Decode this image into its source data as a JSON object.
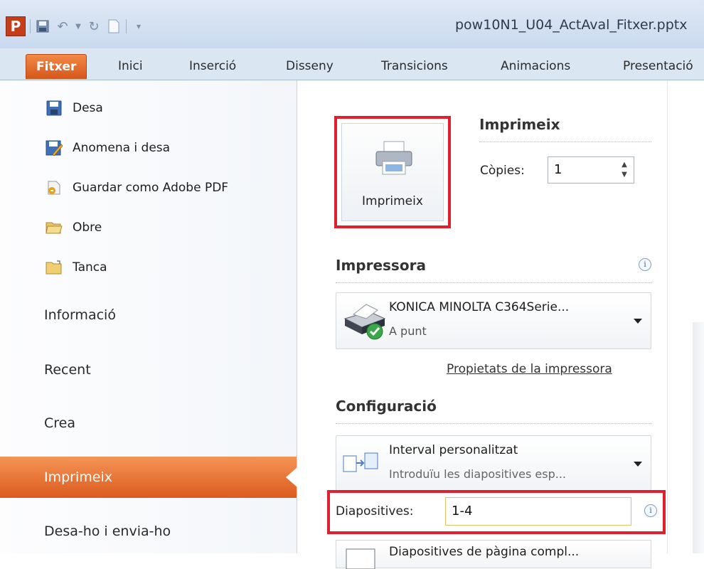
{
  "window": {
    "title": "pow10N1_U04_ActAval_Fitxer.pptx"
  },
  "quick_access": {
    "app_logo": "P"
  },
  "ribbon_tabs": [
    "Fitxer",
    "Inici",
    "Inserció",
    "Disseny",
    "Transicions",
    "Animacions",
    "Presentació"
  ],
  "file_menu": {
    "commands": [
      {
        "label": "Desa",
        "icon": "save-icon"
      },
      {
        "label": "Anomena i desa",
        "icon": "save-as-icon"
      },
      {
        "label": "Guardar como Adobe PDF",
        "icon": "pdf-icon"
      },
      {
        "label": "Obre",
        "icon": "folder-open-icon"
      },
      {
        "label": "Tanca",
        "icon": "folder-close-icon"
      }
    ],
    "nav": [
      "Informació",
      "Recent",
      "Crea",
      "Imprimeix",
      "Desa-ho i envia-ho"
    ],
    "selected": "Imprimeix"
  },
  "print": {
    "button_label": "Imprimeix",
    "heading": "Imprimeix",
    "copies_label": "Còpies:",
    "copies_value": "1"
  },
  "printer": {
    "heading": "Impressora",
    "name": "KONICA MINOLTA C364Serie...",
    "status": "A punt",
    "properties_link": "Propietats de la impressora"
  },
  "settings": {
    "heading": "Configuració",
    "range_title": "Interval personalitzat",
    "range_desc": "Introduïu les diapositives esp...",
    "slides_label": "Diapositives:",
    "slides_value": "1-4",
    "layout_title": "Diapositives de pàgina compl..."
  },
  "colors": {
    "accent": "#d5561a",
    "highlight_border": "#e0212d"
  }
}
